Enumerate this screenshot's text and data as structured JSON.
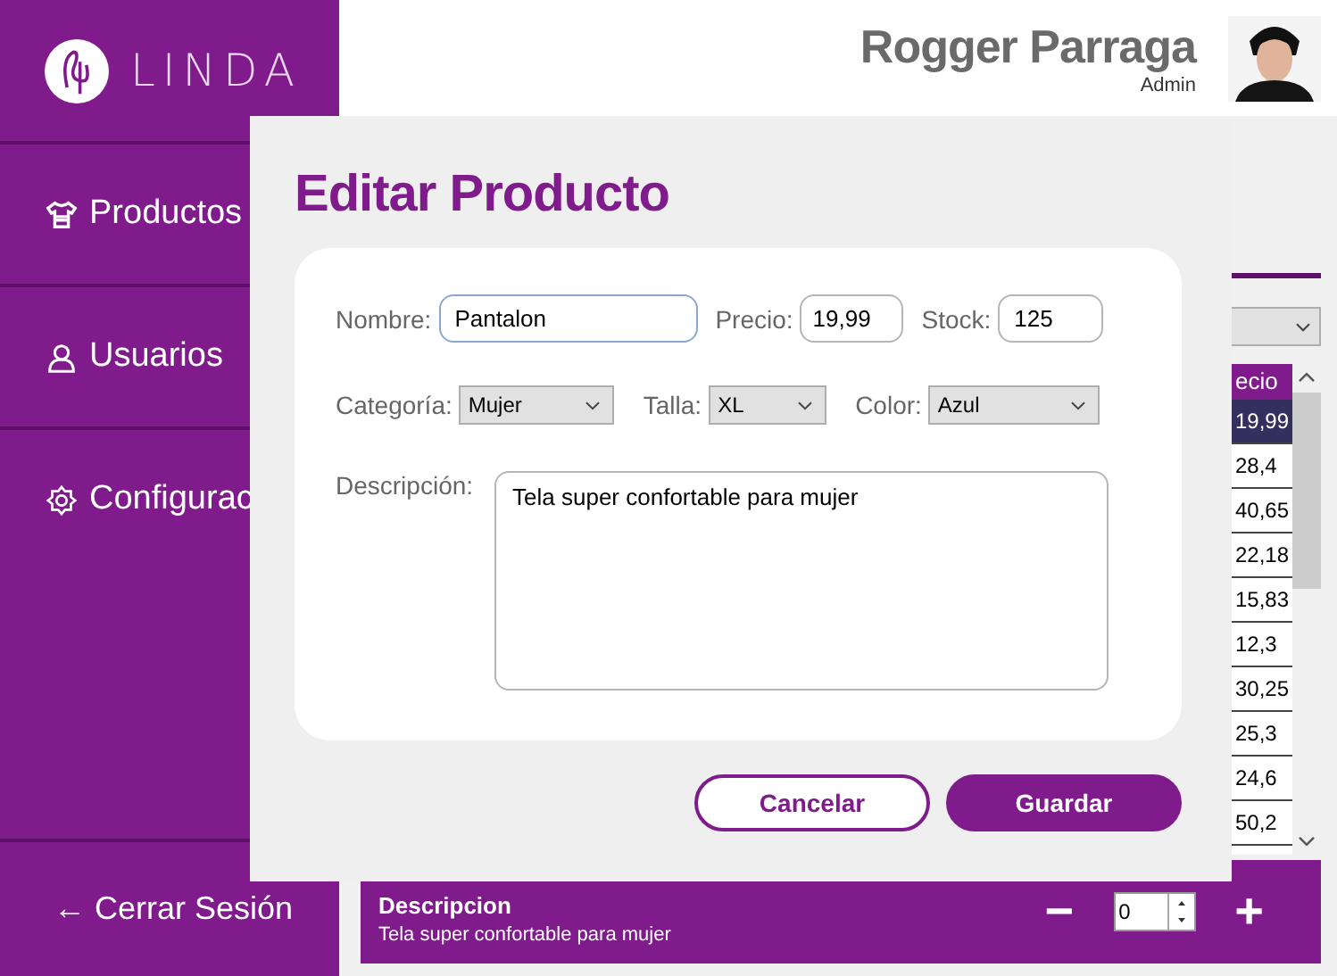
{
  "brand": {
    "name": "LINDA"
  },
  "sidebar": {
    "items": [
      {
        "label": "Productos",
        "kind": "shirt"
      },
      {
        "label": "Usuarios",
        "kind": "user"
      },
      {
        "label": "Configurac",
        "kind": "gear"
      }
    ],
    "logout": "← Cerrar Sesión"
  },
  "user": {
    "name": "Rogger Parraga",
    "role": "Admin"
  },
  "table": {
    "columns": [
      "ecio"
    ],
    "rows": [
      {
        "cells": [
          "19,99"
        ],
        "selected": true
      },
      {
        "cells": [
          "28,4"
        ],
        "selected": false
      },
      {
        "cells": [
          "40,65"
        ],
        "selected": false
      },
      {
        "cells": [
          "22,18"
        ],
        "selected": false
      },
      {
        "cells": [
          "15,83"
        ],
        "selected": false
      },
      {
        "cells": [
          "12,3"
        ],
        "selected": false
      },
      {
        "cells": [
          "30,25"
        ],
        "selected": false
      },
      {
        "cells": [
          "25,3"
        ],
        "selected": false
      },
      {
        "cells": [
          "24,6"
        ],
        "selected": false
      },
      {
        "cells": [
          "50,2"
        ],
        "selected": false
      }
    ]
  },
  "detail_panel": {
    "heading": "Descripcion",
    "text": "Tela super confortable para mujer",
    "minus": "−",
    "quantity": "0",
    "plus": "+"
  },
  "dialog": {
    "title": "Editar Producto",
    "rows": [
      {
        "fields": [
          {
            "kind": "text",
            "label": "Nombre:",
            "value": "Pantalon",
            "focused": true
          },
          {
            "kind": "text",
            "label": "Precio:",
            "value": "19,99",
            "focused": false
          },
          {
            "kind": "text",
            "label": "Stock:",
            "value": "125",
            "focused": false
          }
        ]
      },
      {
        "fields": [
          {
            "kind": "select",
            "label": "Categoría:",
            "value": "Mujer",
            "focused": false
          },
          {
            "kind": "select",
            "label": "Talla:",
            "value": "XL",
            "focused": false
          },
          {
            "kind": "select",
            "label": "Color:",
            "value": "Azul",
            "focused": false
          }
        ]
      },
      {
        "fields": [
          {
            "kind": "textarea",
            "label": "Descripción:",
            "value": "Tela super confortable para mujer",
            "focused": false
          }
        ]
      }
    ],
    "buttons": [
      {
        "label": "Cancelar",
        "kind": "secondary"
      },
      {
        "label": "Guardar",
        "kind": "primary"
      }
    ]
  }
}
